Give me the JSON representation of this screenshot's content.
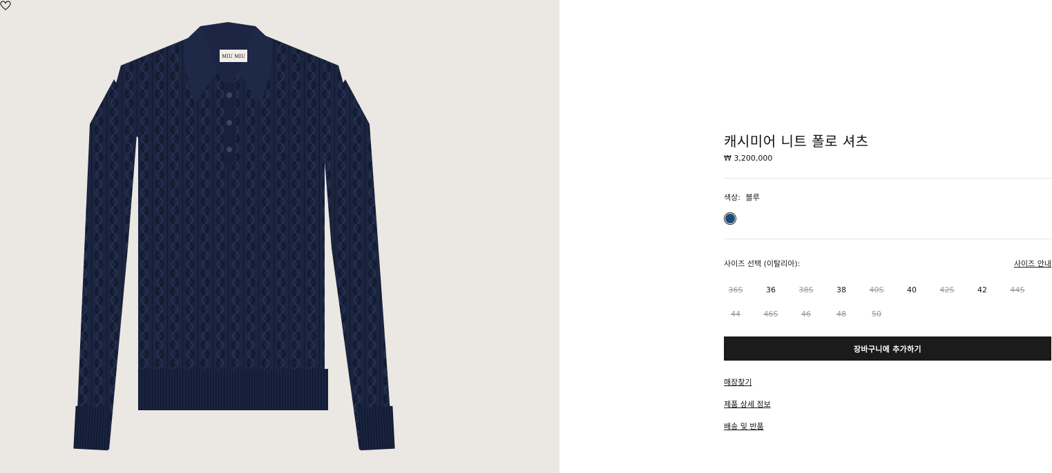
{
  "product": {
    "name": "캐시미어 니트 폴로 셔츠",
    "price": "₩ 3,200,000",
    "brand_label": "MIU MIU",
    "image_background": "#ebe7e2",
    "garment_color": "#1b2540"
  },
  "color": {
    "label": "색상:",
    "value": "블루",
    "swatch_hex": "#1f4a78"
  },
  "size": {
    "label": "사이즈 선택 (이탈리아):",
    "guide_link": "사이즈 안내",
    "options": [
      {
        "label": "36S",
        "available": false
      },
      {
        "label": "36",
        "available": true
      },
      {
        "label": "38S",
        "available": false
      },
      {
        "label": "38",
        "available": true
      },
      {
        "label": "40S",
        "available": false
      },
      {
        "label": "40",
        "available": true
      },
      {
        "label": "42S",
        "available": false
      },
      {
        "label": "42",
        "available": true
      },
      {
        "label": "44S",
        "available": false
      },
      {
        "label": "44",
        "available": false
      },
      {
        "label": "46S",
        "available": false
      },
      {
        "label": "46",
        "available": false
      },
      {
        "label": "48",
        "available": false
      },
      {
        "label": "50",
        "available": false
      }
    ]
  },
  "actions": {
    "add_to_cart": "장바구니에 추가하기",
    "find_store": "매장찾기",
    "product_details": "제품 상세 정보",
    "shipping_returns": "배송 및 반품"
  },
  "icons": {
    "wishlist": "heart-icon"
  }
}
